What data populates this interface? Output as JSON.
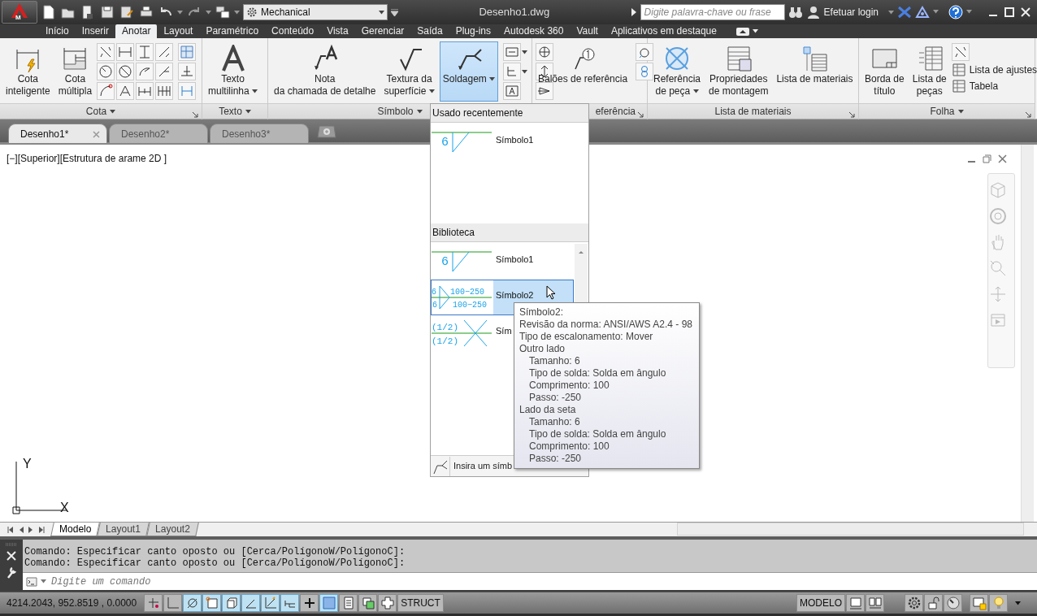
{
  "app_button": {
    "label": "M"
  },
  "workspace": "Mechanical",
  "title": "Desenho1.dwg",
  "search": {
    "placeholder": "Digite palavra-chave ou frase"
  },
  "login": "Efetuar login",
  "ribbon_tabs": [
    {
      "label": "Início",
      "selected": false
    },
    {
      "label": "Inserir",
      "selected": false
    },
    {
      "label": "Anotar",
      "selected": true
    },
    {
      "label": "Layout",
      "selected": false
    },
    {
      "label": "Paramétrico",
      "selected": false
    },
    {
      "label": "Conteúdo",
      "selected": false
    },
    {
      "label": "Vista",
      "selected": false
    },
    {
      "label": "Gerenciar",
      "selected": false
    },
    {
      "label": "Saída",
      "selected": false
    },
    {
      "label": "Plug-ins",
      "selected": false
    },
    {
      "label": "Autodesk 360",
      "selected": false
    },
    {
      "label": "Vault",
      "selected": false
    },
    {
      "label": "Aplicativos em destaque",
      "selected": false
    }
  ],
  "panels": [
    {
      "title": "Cota",
      "dropdown": true,
      "launcher": true,
      "items": [
        {
          "kind": "large",
          "label": "Cota\ninteligente",
          "split": false,
          "active": false
        },
        {
          "kind": "large",
          "label": "Cota\nmúltipla",
          "split": false,
          "active": false
        },
        {
          "kind": "grid"
        },
        {
          "kind": "column",
          "rows": [
            {
              "split": false
            },
            {
              "split": false
            },
            {
              "split": false
            }
          ]
        }
      ]
    },
    {
      "title": "Texto",
      "dropdown": true,
      "launcher": false,
      "items": [
        {
          "kind": "large",
          "label": "Texto\nmultilinha",
          "split": true,
          "active": false
        }
      ]
    },
    {
      "title": "Símbolo",
      "dropdown": true,
      "launcher": false,
      "items": [
        {
          "kind": "large",
          "label": "Nota\nda chamada de detalhe",
          "split": false,
          "active": false
        },
        {
          "kind": "large",
          "label": "Textura da\nsuperfície",
          "split": true,
          "active": false
        },
        {
          "kind": "large",
          "label": "Soldagem",
          "split": true,
          "active": true
        },
        {
          "kind": "column",
          "rows": [
            {
              "split": true
            },
            {
              "split": true
            },
            {
              "split": false
            }
          ]
        },
        {
          "kind": "column",
          "rows": [
            {
              "split": false
            },
            {
              "split": false
            },
            {
              "split": false
            }
          ]
        }
      ]
    },
    {
      "title": "eferência",
      "dropdown": false,
      "launcher": true,
      "items": [
        {
          "kind": "large",
          "label": "Balões de referência",
          "split": false,
          "active": false
        },
        {
          "kind": "column",
          "rows": [
            {
              "split": false
            },
            {
              "split": false
            }
          ]
        }
      ]
    },
    {
      "title": "Lista de materiais",
      "dropdown": false,
      "launcher": true,
      "items": [
        {
          "kind": "large",
          "label": "Referência\nde peça",
          "split": true,
          "active": false
        },
        {
          "kind": "large",
          "label": "Propriedades\nde montagem",
          "split": false,
          "active": false
        },
        {
          "kind": "large",
          "label": "Lista de materiais",
          "split": false,
          "active": false
        }
      ]
    },
    {
      "title": "Folha",
      "dropdown": true,
      "launcher": true,
      "items": [
        {
          "kind": "large",
          "label": "Borda de\ntítulo",
          "split": false,
          "active": false
        },
        {
          "kind": "large",
          "label": "Lista de\npeças",
          "split": false,
          "active": false
        },
        {
          "kind": "list",
          "labels": [
            "Lista de ajustes",
            "Tabela"
          ]
        }
      ]
    }
  ],
  "doc_tabs": [
    {
      "label": "Desenho1*",
      "selected": true
    },
    {
      "label": "Desenho2*",
      "selected": false
    },
    {
      "label": "Desenho3*",
      "selected": false
    }
  ],
  "viewport_label": "[−][Superior][Estrutura de arame 2D ]",
  "ucs": {
    "y_label": "Y",
    "x_label": "X"
  },
  "weld_menu": {
    "sections": [
      {
        "title": "Usado recentemente",
        "scrollable": false,
        "items": [
          {
            "label": "Símbolo1",
            "kind": "fillet",
            "selected": false,
            "texts": [
              "6"
            ]
          }
        ]
      },
      {
        "title": "Biblioteca",
        "scrollable": true,
        "items": [
          {
            "label": "Símbolo1",
            "kind": "fillet",
            "selected": false,
            "texts": [
              "6"
            ]
          },
          {
            "label": "Símbolo2",
            "kind": "fillet_both",
            "selected": true,
            "texts": [
              "6",
              "100−250",
              "6",
              "100−250"
            ]
          },
          {
            "label": "Sím",
            "kind": "cross",
            "selected": false,
            "texts": [
              "(1/2)",
              "(1/2)"
            ]
          }
        ]
      }
    ],
    "footer": "Insira um símb"
  },
  "tooltip": {
    "title": "Símbolo2:",
    "lines": [
      "Revisão da norma: ANSI/AWS A2.4 - 98",
      "Tipo de escalonamento: Mover"
    ],
    "groups": [
      {
        "heading": "Outro lado",
        "children": [
          "Tamanho: 6",
          "Tipo de solda: Solda em ângulo",
          "Comprimento: 100",
          "Passo: -250"
        ]
      },
      {
        "heading": "Lado da seta",
        "children": [
          "Tamanho: 6",
          "Tipo de solda: Solda em ângulo",
          "Comprimento: 100",
          "Passo: -250"
        ]
      }
    ]
  },
  "layout_tabs": [
    {
      "label": "Modelo",
      "selected": true
    },
    {
      "label": "Layout1",
      "selected": false
    },
    {
      "label": "Layout2",
      "selected": false
    }
  ],
  "command": {
    "history": [
      "Comando: Especificar canto oposto ou [Cerca/PolígonoW/PolígonoC]:",
      "Comando: Especificar canto oposto ou [Cerca/PolígonoW/PolígonoC]:"
    ],
    "placeholder": "Digite um comando"
  },
  "status": {
    "coords": "4214.2043, 952.8519 , 0.0000",
    "toggles": [
      {
        "on": false
      },
      {
        "on": false
      },
      {
        "on": true
      },
      {
        "on": true
      },
      {
        "on": true
      },
      {
        "on": true
      },
      {
        "on": true
      },
      {
        "on": true
      },
      {
        "on": false
      },
      {
        "on": true
      },
      {
        "on": false
      },
      {
        "on": false
      },
      {
        "on": false
      }
    ],
    "struct": {
      "label": "STRUCT",
      "on": false
    },
    "space": "MODELO"
  }
}
